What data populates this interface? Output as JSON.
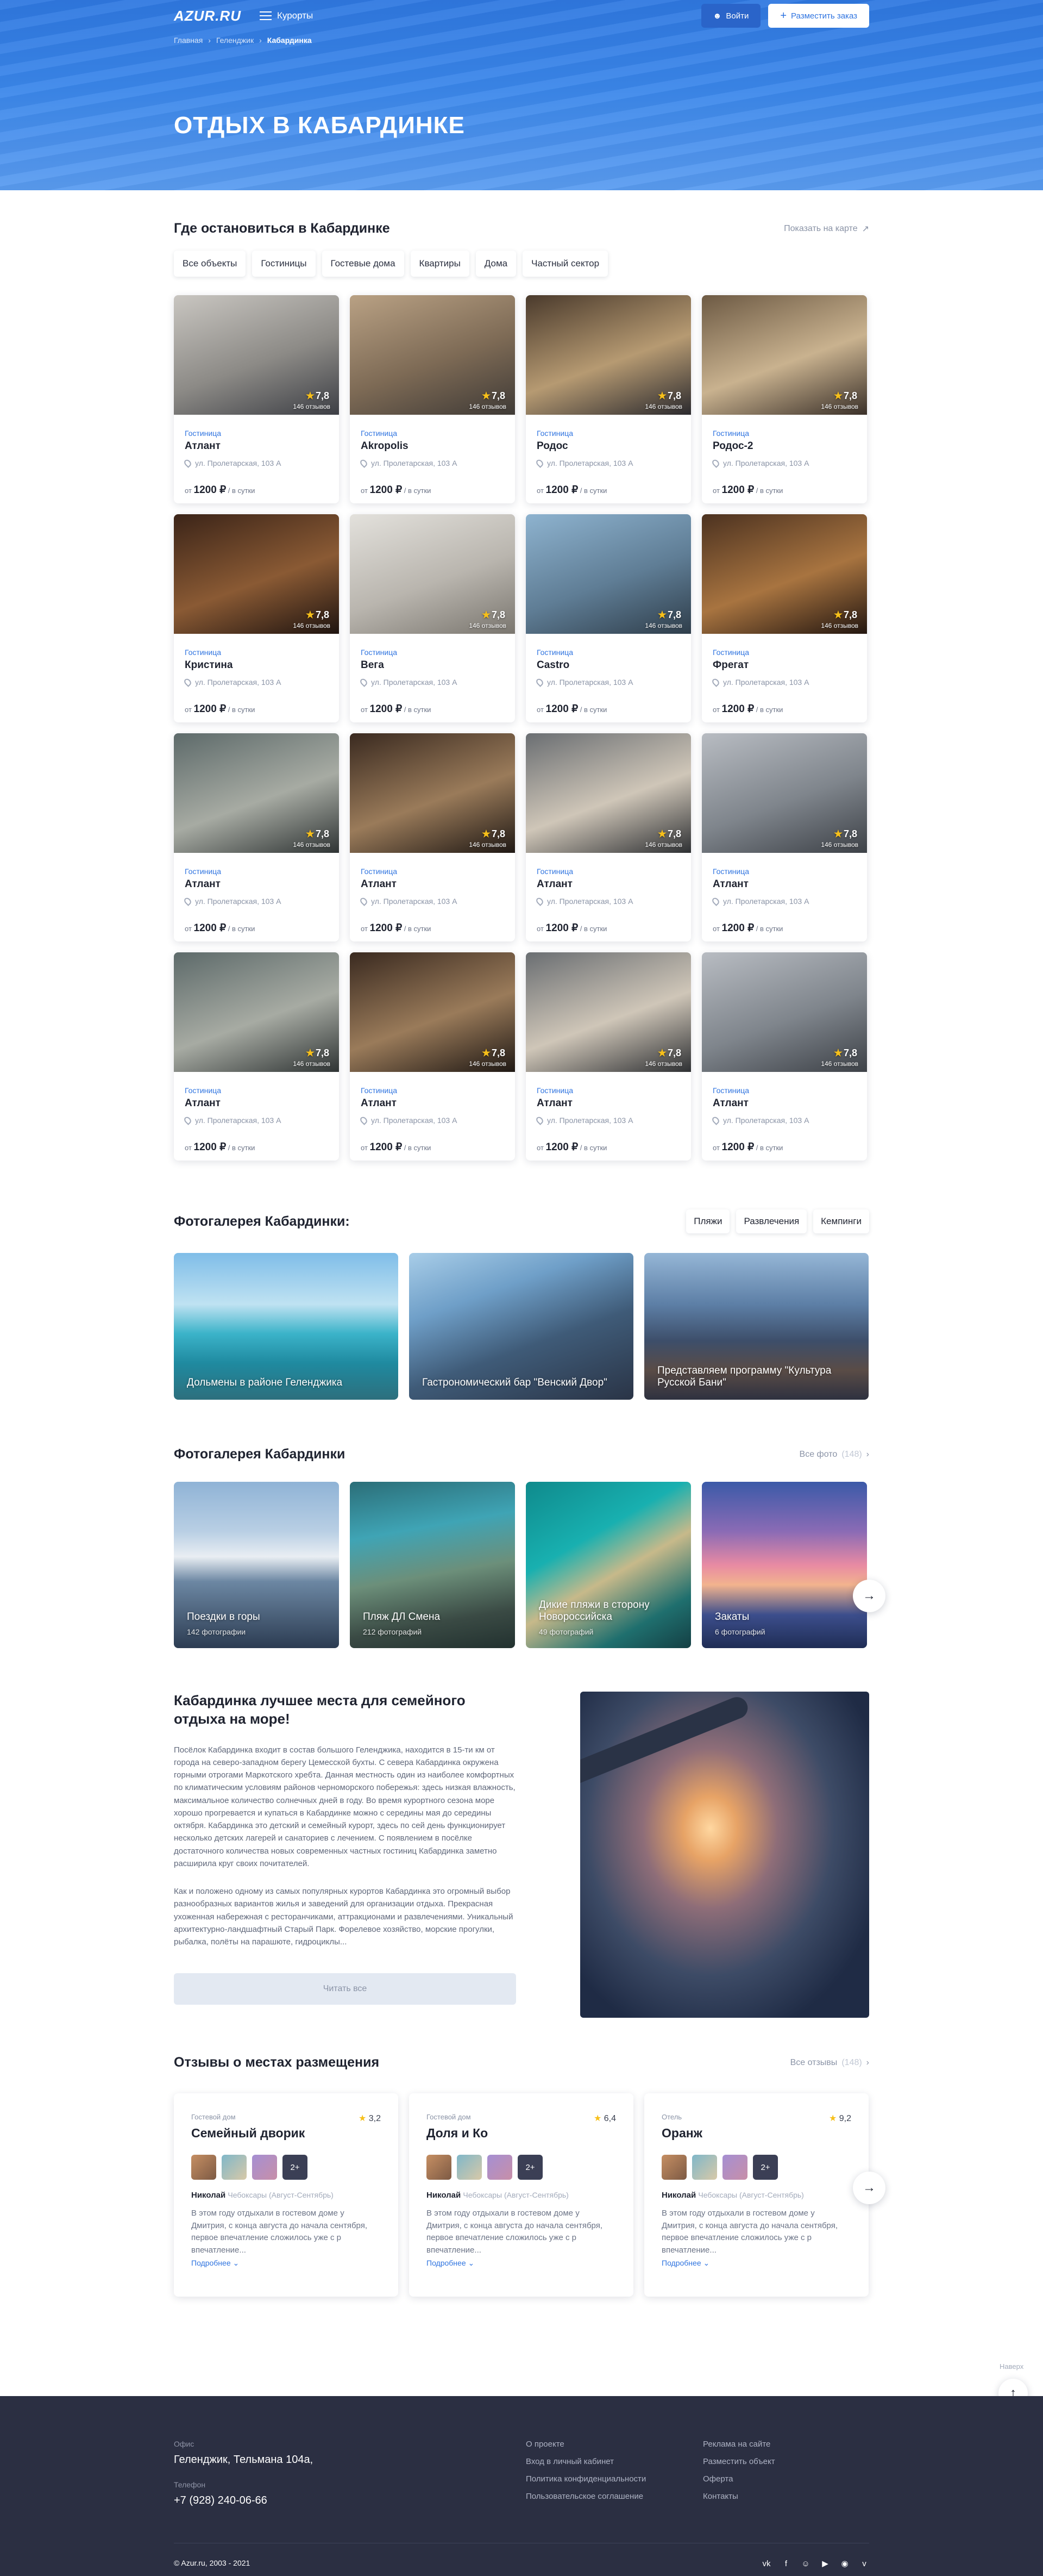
{
  "header": {
    "logo": "AZUR.RU",
    "menu_label": "Курорты",
    "login_label": "Войти",
    "post_label": "Разместить заказ"
  },
  "breadcrumbs": [
    "Главная",
    "Геленджик",
    "Кабардинка"
  ],
  "page_title": "ОТДЫХ В КАБАРДИНКЕ",
  "stay": {
    "title": "Где остановиться в Кабардинке",
    "map_link": "Показать на карте",
    "tabs": [
      "Все объекты",
      "Гостиницы",
      "Гостевые дома",
      "Квартиры",
      "Дома",
      "Частный сектор"
    ],
    "price_prefix": "от",
    "price_suffix": "/ в сутки",
    "cards": [
      {
        "type": "Гостиница",
        "name": "Атлант",
        "address": "ул. Пролетарская, 103 А",
        "rating": "7,8",
        "reviews": "146 отзывов",
        "price": "1200 ₽"
      },
      {
        "type": "Гостиница",
        "name": "Akropolis",
        "address": "ул. Пролетарская, 103 А",
        "rating": "7,8",
        "reviews": "146 отзывов",
        "price": "1200 ₽"
      },
      {
        "type": "Гостиница",
        "name": "Родос",
        "address": "ул. Пролетарская, 103 А",
        "rating": "7,8",
        "reviews": "146 отзывов",
        "price": "1200 ₽"
      },
      {
        "type": "Гостиница",
        "name": "Родос-2",
        "address": "ул. Пролетарская, 103 А",
        "rating": "7,8",
        "reviews": "146 отзывов",
        "price": "1200 ₽"
      },
      {
        "type": "Гостиница",
        "name": "Кристина",
        "address": "ул. Пролетарская, 103 А",
        "rating": "7,8",
        "reviews": "146 отзывов",
        "price": "1200 ₽"
      },
      {
        "type": "Гостиница",
        "name": "Вега",
        "address": "ул. Пролетарская, 103 А",
        "rating": "7,8",
        "reviews": "146 отзывов",
        "price": "1200 ₽"
      },
      {
        "type": "Гостиница",
        "name": "Castro",
        "address": "ул. Пролетарская, 103 А",
        "rating": "7,8",
        "reviews": "146 отзывов",
        "price": "1200 ₽"
      },
      {
        "type": "Гостиница",
        "name": "Фрегат",
        "address": "ул. Пролетарская, 103 А",
        "rating": "7,8",
        "reviews": "146 отзывов",
        "price": "1200 ₽"
      },
      {
        "type": "Гостиница",
        "name": "Атлант",
        "address": "ул. Пролетарская, 103 А",
        "rating": "7,8",
        "reviews": "146 отзывов",
        "price": "1200 ₽"
      },
      {
        "type": "Гостиница",
        "name": "Атлант",
        "address": "ул. Пролетарская, 103 А",
        "rating": "7,8",
        "reviews": "146 отзывов",
        "price": "1200 ₽"
      },
      {
        "type": "Гостиница",
        "name": "Атлант",
        "address": "ул. Пролетарская, 103 А",
        "rating": "7,8",
        "reviews": "146 отзывов",
        "price": "1200 ₽"
      },
      {
        "type": "Гостиница",
        "name": "Атлант",
        "address": "ул. Пролетарская, 103 А",
        "rating": "7,8",
        "reviews": "146 отзывов",
        "price": "1200 ₽"
      },
      {
        "type": "Гостиница",
        "name": "Атлант",
        "address": "ул. Пролетарская, 103 А",
        "rating": "7,8",
        "reviews": "146 отзывов",
        "price": "1200 ₽"
      },
      {
        "type": "Гостиница",
        "name": "Атлант",
        "address": "ул. Пролетарская, 103 А",
        "rating": "7,8",
        "reviews": "146 отзывов",
        "price": "1200 ₽"
      },
      {
        "type": "Гостиница",
        "name": "Атлант",
        "address": "ул. Пролетарская, 103 А",
        "rating": "7,8",
        "reviews": "146 отзывов",
        "price": "1200 ₽"
      },
      {
        "type": "Гостиница",
        "name": "Атлант",
        "address": "ул. Пролетарская, 103 А",
        "rating": "7,8",
        "reviews": "146 отзывов",
        "price": "1200 ₽"
      }
    ]
  },
  "gallery1": {
    "title": "Фотогалерея Кабардинки:",
    "tabs": [
      "Пляжи",
      "Развлечения",
      "Кемпинги"
    ],
    "tiles": [
      {
        "caption": "Дольмены в районе Геленджика"
      },
      {
        "caption": "Гастрономический бар \"Венский Двор\""
      },
      {
        "caption": "Представляем программу \"Культура Русской Бани\""
      }
    ]
  },
  "gallery2": {
    "title": "Фотогалерея Кабардинки",
    "all_link": "Все фото",
    "all_count": "(148)",
    "tiles": [
      {
        "caption": "Поездки в горы",
        "count": "142 фотографии"
      },
      {
        "caption": "Пляж ДЛ Смена",
        "count": "212 фотографий"
      },
      {
        "caption": "Дикие пляжи в сторону Новороссийска",
        "count": "49 фотографий"
      },
      {
        "caption": "Закаты",
        "count": "6 фотографий"
      }
    ]
  },
  "about": {
    "title": "Кабардинка лучшее места для семейного отдыха на море!",
    "p1": "Посёлок Кабардинка входит в состав большого Геленджика, находится в 15-ти км от города на северо-западном берегу Цемесской бухты. С севера Кабардинка окружена горными отрогами Маркотского хребта. Данная местность один из наиболее комфортных по климатическим условиям районов черноморского побережья: здесь низкая влажность, максимальное количество солнечных дней в году. Во время курортного сезона море хорошо прогревается и купаться в Кабардинке можно с середины мая до середины октября. Кабардинка это детский и семейный курорт, здесь по сей день функционирует несколько детских лагерей и санаториев с лечением. С появлением в посёлке достаточного количества новых современных частных гостиниц Кабардинка заметно расширила круг своих почитателей.",
    "p2": "Как и положено одному из самых популярных курортов Кабардинка это огромный выбор разнообразных вариантов жилья и заведений для организации отдыха. Прекрасная ухоженная набережная с ресторанчиками, аттракционами и развлечениями. Уникальный архитектурно-ландшафтный Старый Парк. Форелевое хозяйство, морские прогулки, рыбалка, полёты на парашюте, гидроциклы...",
    "read_all": "Читать все"
  },
  "reviews": {
    "title": "Отзывы о местах размещения",
    "all_link": "Все отзывы",
    "all_count": "(148)",
    "more_label": "Подробнее",
    "thumbs_more": "2+",
    "items": [
      {
        "type": "Гостевой дом",
        "name": "Семейный дворик",
        "score": "3,2",
        "author": "Николай",
        "meta": "Чебоксары (Август-Сентябрь)",
        "text": "В этом году отдыхали в гостевом доме у Дмитрия, с конца августа до начала сентября, первое впечатление сложилось уже с р впечатление..."
      },
      {
        "type": "Гостевой дом",
        "name": "Доля и Ко",
        "score": "6,4",
        "author": "Николай",
        "meta": "Чебоксары (Август-Сентябрь)",
        "text": "В этом году отдыхали в гостевом доме у Дмитрия, с конца августа до начала сентября, первое впечатление сложилось уже с р впечатление..."
      },
      {
        "type": "Отель",
        "name": "Оранж",
        "score": "9,2",
        "author": "Николай",
        "meta": "Чебоксары (Август-Сентябрь)",
        "text": "В этом году отдыхали в гостевом доме у Дмитрия, с конца августа до начала сентября, первое впечатление сложилось уже с р впечатление..."
      }
    ]
  },
  "footer": {
    "office_label": "Офис",
    "office_value": "Геленджик, Тельмана 104а,",
    "phone_label": "Телефон",
    "phone_value": "+7 (928) 240-06-66",
    "col1": [
      "О проекте",
      "Вход в личный кабинет",
      "Политика конфиденциальности",
      "Пользовательское соглашение"
    ],
    "col2": [
      "Реклама на сайте",
      "Разместить объект",
      "Оферта",
      "Контакты"
    ],
    "copyright": "© Azur.ru, 2003 - 2021",
    "up_label": "Наверх"
  },
  "colors": {
    "accent": "#2f74e0",
    "footer_bg": "#2b2f42",
    "star": "#f7c01a"
  }
}
